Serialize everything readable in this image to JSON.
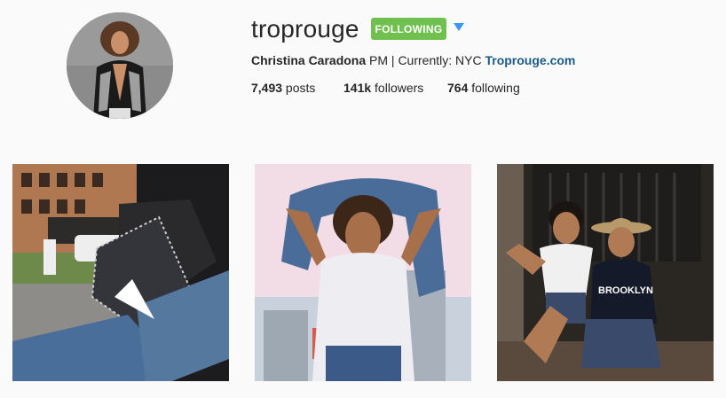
{
  "profile": {
    "username": "troprouge",
    "follow_button_label": "FOLLOWING",
    "bio": {
      "full_name": "Christina Caradona",
      "text": " PM | Currently: NYC ",
      "link_text": "Troprouge.com"
    },
    "stats": {
      "posts_count": "7,493",
      "posts_label": " posts",
      "followers_count": "141k",
      "followers_label": " followers",
      "following_count": "764",
      "following_label": " following"
    }
  },
  "icons": {
    "dropdown": "caret-down-icon"
  },
  "colors": {
    "follow_button": "#70c050",
    "link": "#1a5a8a",
    "dropdown_caret": "#3897f0",
    "background": "#fafafa"
  }
}
